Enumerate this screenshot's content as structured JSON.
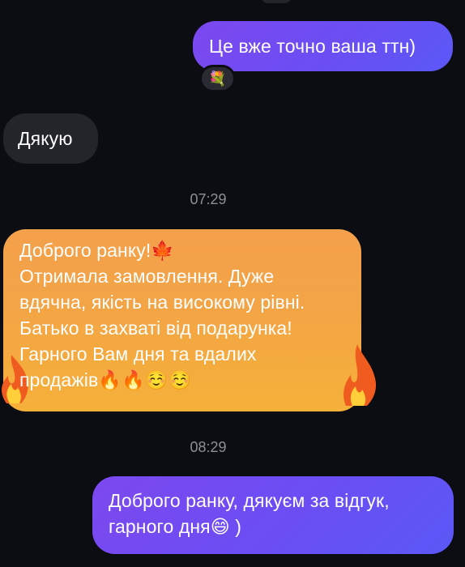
{
  "messages": [
    {
      "id": "m1",
      "direction": "outgoing",
      "text": "Це вже точно ваша ттн)",
      "reaction": "💐"
    },
    {
      "id": "m2",
      "direction": "incoming",
      "text": "Дякую"
    },
    {
      "id": "ts1",
      "type": "timestamp",
      "text": "07:29"
    },
    {
      "id": "m3",
      "direction": "incoming",
      "style": "autumn-fire-effect",
      "lines": [
        "Доброго ранку!🍁",
        "Отримала замовлення. Дуже",
        "вдячна, якість на високому рівні.",
        "Батько в захваті від подарунка!",
        "Гарного Вам дня та вдалих",
        "продажів🔥🔥☺️☺️"
      ]
    },
    {
      "id": "ts2",
      "type": "timestamp",
      "text": "08:29"
    },
    {
      "id": "m4",
      "direction": "outgoing",
      "lines": [
        "Доброго ранку, дякуєм за відгук,",
        "гарного дня😄 )"
      ]
    }
  ],
  "colors": {
    "background": "#0b0d12",
    "outgoing_bubble": "#6a4ef4",
    "incoming_bubble": "#24252b",
    "effect_bubble": "#f4a446",
    "timestamp_text": "#8e8f96"
  }
}
